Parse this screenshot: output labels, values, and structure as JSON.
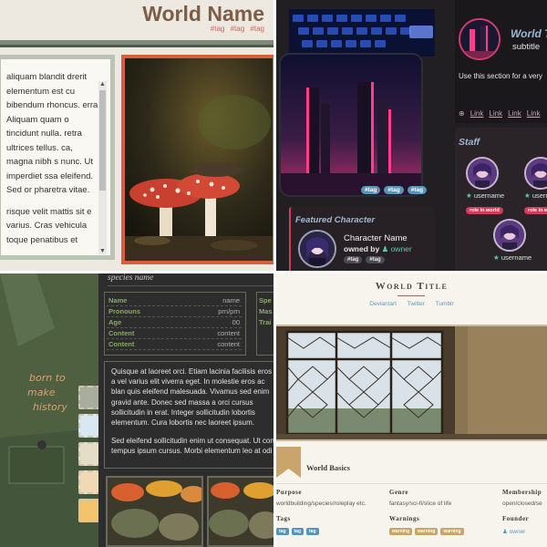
{
  "colors": {
    "q1_title": "#7c5d45",
    "q1_tags": "#c96a54",
    "q1_frame_accent": "#d6603c",
    "q2_bg": "#221f22",
    "q2_heading": "#9fb7cf",
    "q2_tag": "#5a93b8",
    "q2_role": "#d23b5a",
    "q2_owner": "#5cc8a8",
    "q3_label": "#8aa96a",
    "q4_link": "#5a9ab5",
    "q4_warning": "#c9a46b"
  },
  "q1": {
    "title": "World Name",
    "tags": [
      "#tag",
      "#tag",
      "#tag"
    ],
    "paragraphs": [
      "aliquam blandit drerit elementum est cu bibendum rhoncus. erra. Aliquam quam o tincidunt nulla. retra ultrices tellus. ca, magna nibh s nunc. Ut imperdiet ssa eleifend. Sed or pharetra vitae.",
      "risque velit mattis sit e varius. Cras vehicula toque penatibus et"
    ],
    "scroll_up": "▲",
    "scroll_down": "▼"
  },
  "q2": {
    "world_title": "World Title",
    "subtitle": "subtitle",
    "description": "Use this section for a very",
    "link_icon": "⊕",
    "links": [
      "Link",
      "Link",
      "Link",
      "Link"
    ],
    "city_tags": [
      "#tag",
      "#tag",
      "#tag"
    ],
    "staff_heading": "Staff",
    "staff": [
      {
        "username": "username",
        "role": "role in world"
      },
      {
        "username": "username",
        "role": "role in w"
      },
      {
        "username": "username",
        "role": ""
      }
    ],
    "star": "★",
    "featured_heading": "Featured Character",
    "character_name": "Character Name",
    "owned_by": "owned by",
    "owner": "owner",
    "person_icon": "♟",
    "character_tags": [
      "#tag",
      "#tag"
    ]
  },
  "q3": {
    "species_name": "species name",
    "stats": [
      {
        "label": "Name",
        "value": "name"
      },
      {
        "label": "Pronouns",
        "value": "prn/prn"
      },
      {
        "label": "Age",
        "value": "00"
      },
      {
        "label": "Content",
        "value": "content"
      },
      {
        "label": "Content",
        "value": "content"
      }
    ],
    "stats_right": [
      "Spe",
      "Mas",
      "Trai"
    ],
    "paragraphs": [
      "Quisque at laoreet orci. Etiam lacinia facilisis eros a vel varius elit viverra eget. In molestie eros ac blan quis eleifend malesuada. Vivamus sed enim gravid ante. Donec sed massa a orci cursus sollicitudin in erat. Integer sollicitudin lobortis elementum. Cura lobortis nec laoreet ipsum.",
      "Sed eleifend sollicitudin enim ut consequat. Ut con tempus ipsum cursus. Morbi elementum leo at odi"
    ],
    "swatch_colors": [
      "#a8ad9c",
      "#d9e8f0",
      "#e6ddc8",
      "#f0d9b5",
      "#f2c46c"
    ]
  },
  "q4": {
    "title": "World Title",
    "links": [
      "Deviantart",
      "Twitter",
      "Tumblr"
    ],
    "basics_heading": "World Basics",
    "purpose_label": "Purpose",
    "purpose_value": "worldbuilding/species/roleplay etc.",
    "genre_label": "Genre",
    "genre_value": "fantasy/sci-fi/slice of life",
    "membership_label": "Membership",
    "membership_value": "open/closed/se",
    "tags_label": "Tags",
    "tags": [
      "tag",
      "tag",
      "tag"
    ],
    "warnings_label": "Warnings",
    "warnings": [
      "warning",
      "warning",
      "warning"
    ],
    "founder_label": "Founder",
    "founder_icon": "♟",
    "founder_value": "owner"
  }
}
